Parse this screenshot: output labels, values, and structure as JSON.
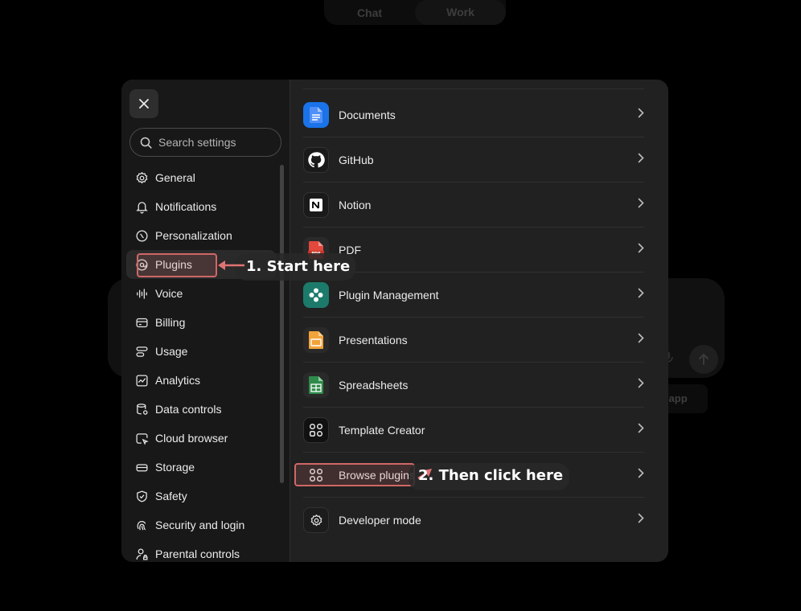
{
  "background": {
    "mode_toggle": [
      "Chat",
      "Work"
    ],
    "chip_text": "p app"
  },
  "sidebar": {
    "search_placeholder": "Search settings",
    "items": [
      {
        "label": "General",
        "icon": "gear-icon"
      },
      {
        "label": "Notifications",
        "icon": "bell-icon"
      },
      {
        "label": "Personalization",
        "icon": "personalization-icon"
      },
      {
        "label": "Plugins",
        "icon": "plugins-icon"
      },
      {
        "label": "Voice",
        "icon": "voice-waveform-icon"
      },
      {
        "label": "Billing",
        "icon": "credit-card-icon"
      },
      {
        "label": "Usage",
        "icon": "usage-icon"
      },
      {
        "label": "Analytics",
        "icon": "analytics-chart-icon"
      },
      {
        "label": "Data controls",
        "icon": "database-icon"
      },
      {
        "label": "Cloud browser",
        "icon": "cloud-browser-icon"
      },
      {
        "label": "Storage",
        "icon": "storage-drive-icon"
      },
      {
        "label": "Safety",
        "icon": "shield-check-icon"
      },
      {
        "label": "Security and login",
        "icon": "fingerprint-icon"
      },
      {
        "label": "Parental controls",
        "icon": "parental-controls-icon"
      }
    ],
    "active_index": 3
  },
  "main": {
    "items": [
      {
        "label": "Documents",
        "icon": "documents-icon"
      },
      {
        "label": "GitHub",
        "icon": "github-icon"
      },
      {
        "label": "Notion",
        "icon": "notion-icon"
      },
      {
        "label": "PDF",
        "icon": "pdf-icon"
      },
      {
        "label": "Plugin Management",
        "icon": "plugin-management-icon"
      },
      {
        "label": "Presentations",
        "icon": "presentations-icon"
      },
      {
        "label": "Spreadsheets",
        "icon": "spreadsheets-icon"
      },
      {
        "label": "Template Creator",
        "icon": "template-creator-icon"
      },
      {
        "label": "Browse plugins",
        "icon": "browse-plugins-icon"
      },
      {
        "label": "Developer mode",
        "icon": "gear-icon"
      }
    ]
  },
  "annotations": {
    "step1": "1. Start here",
    "step2": "2. Then click here",
    "color": "#d06767"
  },
  "colors": {
    "modal_bg": "#212121",
    "sidebar_bg": "#181818",
    "docs_blue": "#1a73e8",
    "pdf_red": "#e2483b",
    "plugin_mgmt_teal": "#1c7a6b",
    "presentations_orange": "#f2a33a",
    "spreadsheets_green": "#2e8b4a"
  }
}
